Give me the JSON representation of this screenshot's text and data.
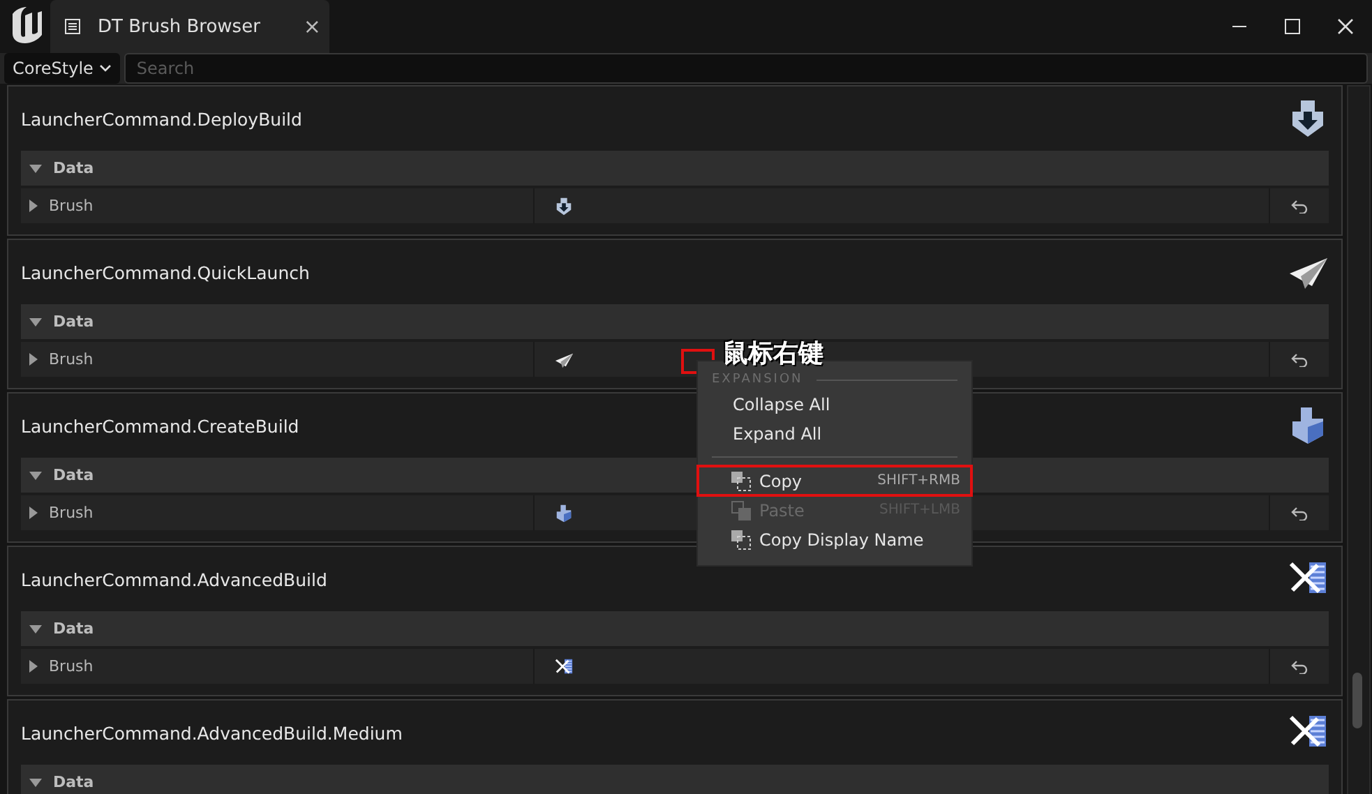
{
  "window": {
    "tab_title": "DT Brush Browser",
    "tab_close": "×"
  },
  "toolbar": {
    "style_dropdown": "CoreStyle",
    "search": {
      "placeholder": "Search"
    }
  },
  "entries": [
    {
      "name": "LauncherCommand.DeployBuild",
      "kind": "deploy",
      "section": "Data",
      "property": "Brush"
    },
    {
      "name": "LauncherCommand.QuickLaunch",
      "kind": "plane",
      "section": "Data",
      "property": "Brush"
    },
    {
      "name": "LauncherCommand.CreateBuild",
      "kind": "create",
      "section": "Data",
      "property": "Brush"
    },
    {
      "name": "LauncherCommand.AdvancedBuild",
      "kind": "tools",
      "section": "Data",
      "property": "Brush"
    },
    {
      "name": "LauncherCommand.AdvancedBuild.Medium",
      "kind": "tools",
      "section": "Data"
    }
  ],
  "context_menu": {
    "section": "EXPANSION",
    "items": [
      {
        "label": "Collapse All",
        "kind": "plain",
        "disabled": false,
        "highlighted": false
      },
      {
        "label": "Expand All",
        "kind": "plain",
        "disabled": false,
        "highlighted": false
      },
      {
        "kind": "separator"
      },
      {
        "label": "Copy",
        "shortcut": "SHIFT+RMB",
        "kind": "copy",
        "disabled": false,
        "highlighted": true
      },
      {
        "label": "Paste",
        "shortcut": "SHIFT+LMB",
        "kind": "paste",
        "disabled": true,
        "highlighted": false
      },
      {
        "label": "Copy Display Name",
        "kind": "copy",
        "disabled": false,
        "highlighted": false
      }
    ]
  },
  "annotation": {
    "text": "鼠标右键"
  }
}
